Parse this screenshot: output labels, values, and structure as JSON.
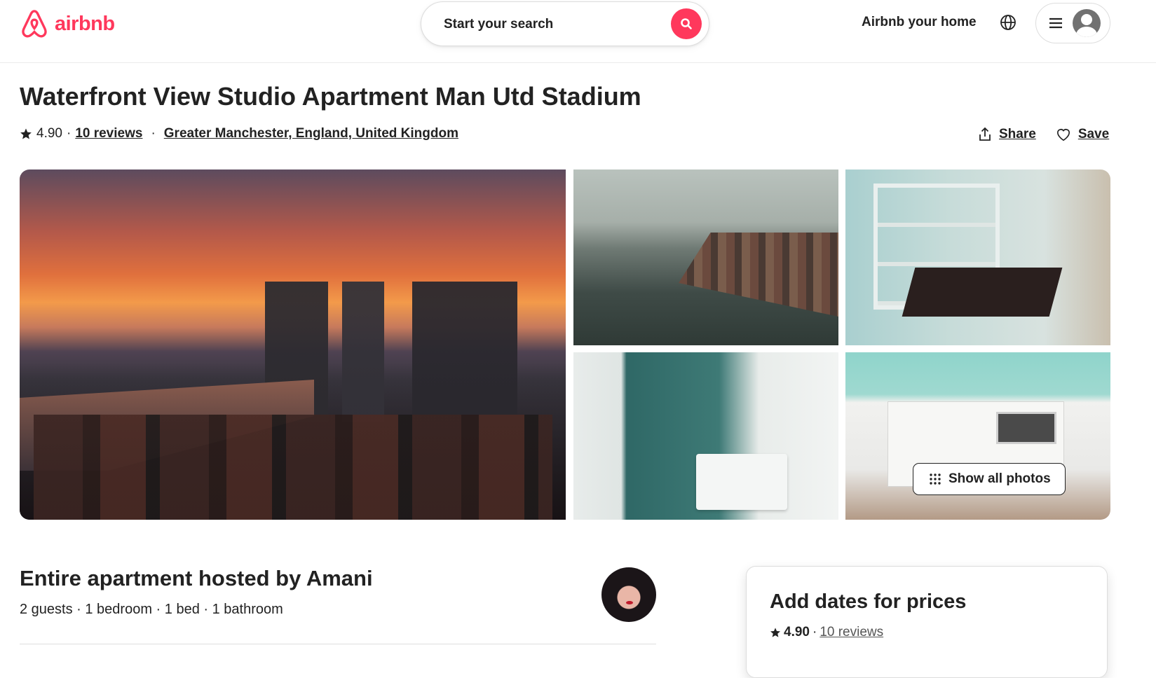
{
  "header": {
    "brand": "airbnb",
    "search_placeholder": "Start your search",
    "host_link": "Airbnb your home",
    "icons": {
      "logo": "airbnb-logo-icon",
      "search": "search-icon",
      "globe": "globe-icon",
      "menu": "hamburger-icon",
      "user": "user-avatar-icon"
    }
  },
  "listing": {
    "title": "Waterfront View Studio Apartment Man Utd Stadium",
    "rating": "4.90",
    "reviews": "10 reviews",
    "dot": "·",
    "location": "Greater Manchester, England, United Kingdom",
    "share": "Share",
    "save": "Save"
  },
  "gallery": {
    "show_all": "Show all photos"
  },
  "summary": {
    "heading": "Entire apartment hosted by Amani",
    "details": "2 guests · 1 bedroom · 1 bed · 1 bathroom"
  },
  "booking": {
    "heading": "Add dates for prices",
    "rating": "4.90",
    "reviews": "10 reviews"
  },
  "colors": {
    "brand": "#FF385C",
    "text": "#222222"
  }
}
